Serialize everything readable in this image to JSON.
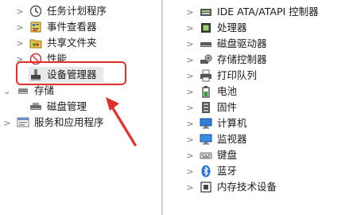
{
  "left_tree": {
    "items": [
      {
        "label": "任务计划程序",
        "icon": "clock-icon",
        "chevron": ">"
      },
      {
        "label": "事件查看器",
        "icon": "event-viewer-icon",
        "chevron": ">"
      },
      {
        "label": "共享文件夹",
        "icon": "shared-folder-icon",
        "chevron": ">"
      },
      {
        "label": "性能",
        "icon": "performance-icon",
        "chevron": ">"
      },
      {
        "label": "设备管理器",
        "icon": "device-manager-icon",
        "chevron": ""
      },
      {
        "label": "存储",
        "icon": "storage-icon",
        "chevron": "⌄"
      },
      {
        "label": "磁盘管理",
        "icon": "disk-management-icon",
        "chevron": ""
      },
      {
        "label": "服务和应用程序",
        "icon": "services-icon",
        "chevron": ">"
      }
    ]
  },
  "device_tree": {
    "items": [
      {
        "label": "IDE ATA/ATAPI 控制器",
        "icon": "ide-controller-icon"
      },
      {
        "label": "处理器",
        "icon": "processor-icon"
      },
      {
        "label": "磁盘驱动器",
        "icon": "disk-drive-icon"
      },
      {
        "label": "存储控制器",
        "icon": "storage-controller-icon"
      },
      {
        "label": "打印队列",
        "icon": "printer-icon"
      },
      {
        "label": "电池",
        "icon": "battery-icon"
      },
      {
        "label": "固件",
        "icon": "firmware-icon"
      },
      {
        "label": "计算机",
        "icon": "computer-icon"
      },
      {
        "label": "监视器",
        "icon": "monitor-icon"
      },
      {
        "label": "键盘",
        "icon": "keyboard-icon"
      },
      {
        "label": "蓝牙",
        "icon": "bluetooth-icon"
      },
      {
        "label": "内存技术设备",
        "icon": "memory-device-icon"
      }
    ],
    "chevron": ">"
  },
  "colors": {
    "annotation": "#e0302c",
    "selection": "#e8e8e8",
    "divider": "#cfcfcf"
  }
}
